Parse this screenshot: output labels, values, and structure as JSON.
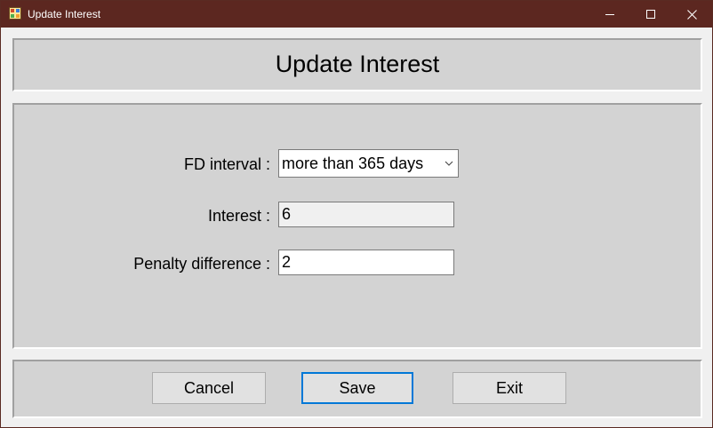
{
  "window": {
    "title": "Update Interest",
    "icon": "app-form-icon",
    "controls": [
      "minimize-icon",
      "maximize-icon",
      "close-icon"
    ]
  },
  "header": {
    "title": "Update Interest"
  },
  "form": {
    "fd_interval_label": "FD interval :",
    "fd_interval_value": "more than 365 days",
    "interest_label": "Interest :",
    "interest_value": "6",
    "penalty_label": "Penalty difference :",
    "penalty_value": "2"
  },
  "buttons": {
    "cancel": "Cancel",
    "save": "Save",
    "exit": "Exit"
  },
  "colors": {
    "titlebar": "#5c2720",
    "panel": "#d3d3d3",
    "focus_border": "#0078d7"
  }
}
